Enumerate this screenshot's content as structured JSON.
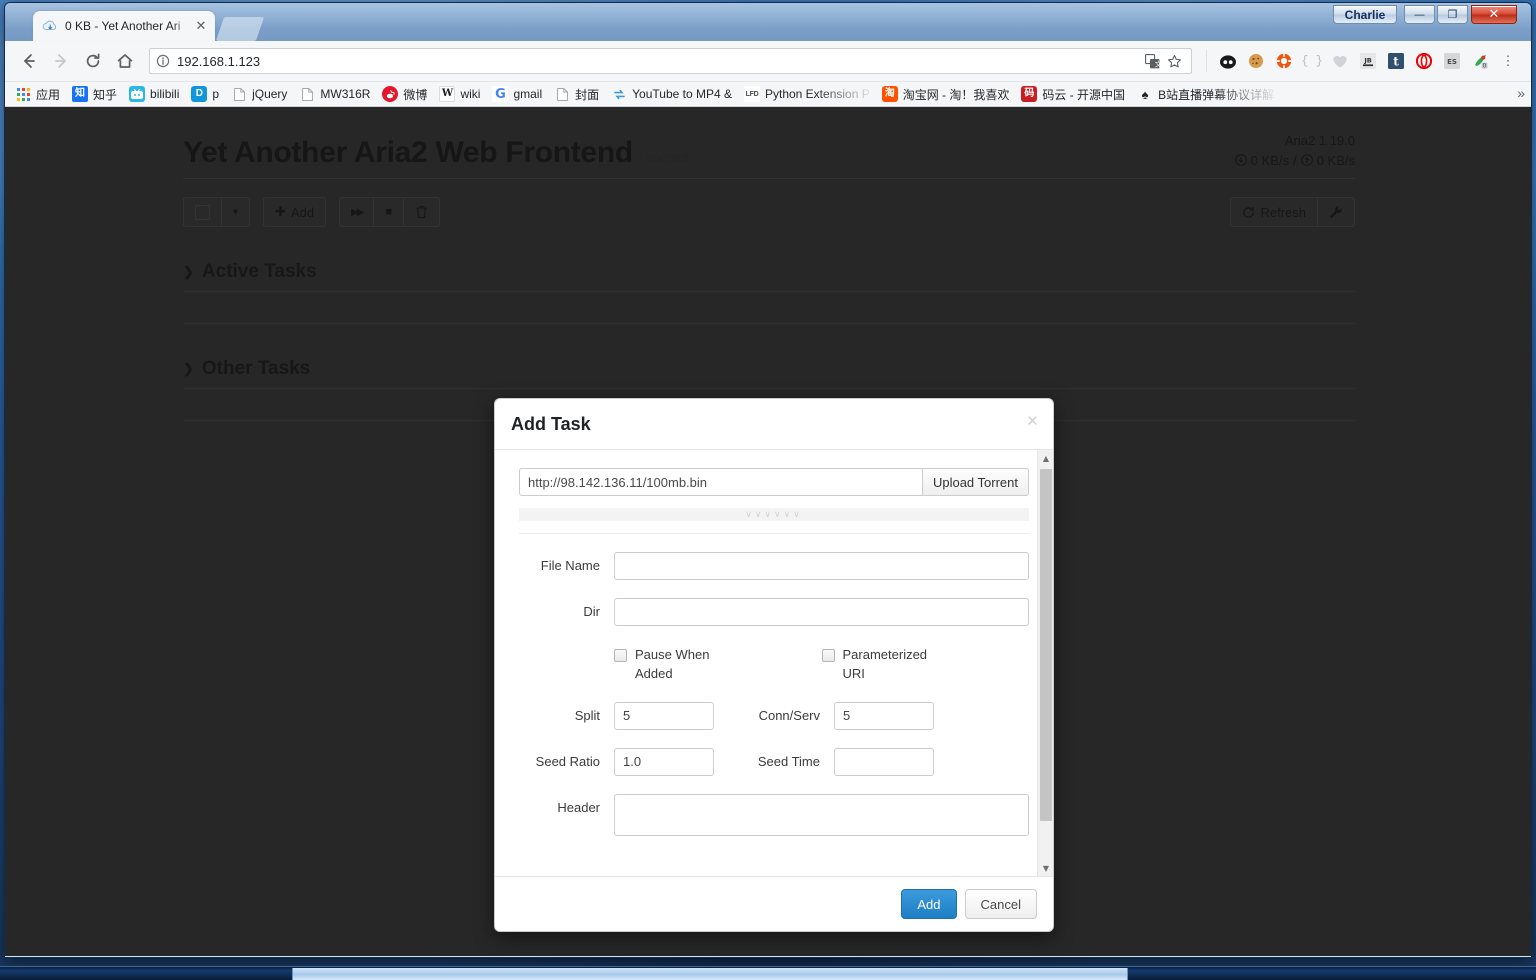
{
  "window": {
    "user_chip": "Charlie",
    "minimize_glyph": "—",
    "maximize_glyph": "❐",
    "close_glyph": "✕"
  },
  "browser": {
    "tab": {
      "title": "0 KB - Yet Another Ari",
      "close_glyph": "✕",
      "favicon_name": "cloud-download-icon"
    },
    "url": "192.168.1.123",
    "nav": {
      "back": "←",
      "forward": "→",
      "reload": "⟳",
      "home": "⌂"
    },
    "omnibox_icons": [
      "translate-icon",
      "star-icon"
    ],
    "extensions": [
      "panda-icon",
      "cookie-icon",
      "lifebuoy-icon",
      "braces-icon",
      "heart-icon",
      "jb-icon",
      "tumblr-icon",
      "opera-icon",
      "es-icon",
      "aria2-icon"
    ],
    "menu_glyph": "⋮",
    "bookmarks": [
      {
        "label": "应用",
        "icon": "apps-grid-icon"
      },
      {
        "label": "知乎",
        "icon": "zhihu-icon"
      },
      {
        "label": "bilibili",
        "icon": "bilibili-icon"
      },
      {
        "label": "p",
        "icon": "p-icon"
      },
      {
        "label": "jQuery",
        "icon": "page-icon"
      },
      {
        "label": "MW316R",
        "icon": "page-icon"
      },
      {
        "label": "微博",
        "icon": "weibo-icon"
      },
      {
        "label": "wiki",
        "icon": "wikipedia-icon"
      },
      {
        "label": "gmail",
        "icon": "google-icon"
      },
      {
        "label": "封面",
        "icon": "page-icon"
      },
      {
        "label": "YouTube to MP4 &",
        "icon": "convert-icon"
      },
      {
        "label": "Python Extension P",
        "icon": "lfd-icon"
      },
      {
        "label": "淘宝网 - 淘！我喜欢",
        "icon": "taobao-icon"
      },
      {
        "label": "码云 - 开源中国",
        "icon": "gitee-icon"
      },
      {
        "label": "B站直播弹幕协议详解",
        "icon": "spade-icon"
      }
    ],
    "bookmarks_overflow_glyph": "»"
  },
  "app": {
    "title": "Yet Another Aria2 Web Frontend",
    "cached_label": "cached",
    "version": "Aria2 1.19.0",
    "download_speed": "0 KB/s",
    "upload_speed": "0 KB/s",
    "speed_separator": "/",
    "toolbar": {
      "select_all_caret": "▾",
      "add_label": "Add",
      "add_glyph": "✚",
      "resume_glyph": "▶▶",
      "stop_glyph": "■",
      "delete_glyph": "🗑",
      "refresh_label": "Refresh",
      "refresh_glyph": "⟳",
      "settings_glyph": "🔧"
    },
    "sections": [
      {
        "name": "Active Tasks",
        "caret": "❯",
        "rows": 1
      },
      {
        "name": "Other Tasks",
        "caret": "❯",
        "rows": 1
      }
    ]
  },
  "modal": {
    "title": "Add Task",
    "close_glyph": "×",
    "uri_value": "http://98.142.136.11/100mb.bin",
    "uri_placeholder": "",
    "upload_torrent_label": "Upload Torrent",
    "resize_handle_glyphs": "∨∨∨∨∨∨",
    "fields": {
      "file_name_label": "File Name",
      "file_name_value": "",
      "dir_label": "Dir",
      "dir_value": "",
      "pause_when_added_label": "Pause When Added",
      "parameterized_uri_label": "Parameterized URI",
      "split_label": "Split",
      "split_value": "5",
      "conn_serv_label": "Conn/Serv",
      "conn_serv_value": "5",
      "seed_ratio_label": "Seed Ratio",
      "seed_ratio_value": "1.0",
      "seed_time_label": "Seed Time",
      "seed_time_value": "",
      "header_label": "Header",
      "header_value": ""
    },
    "footer": {
      "add_label": "Add",
      "cancel_label": "Cancel"
    },
    "scrollbar": {
      "up_glyph": "▲",
      "down_glyph": "▼"
    }
  },
  "colors": {
    "page_bg": "#303030",
    "modal_bg": "#ffffff",
    "primary_button": "#1d7fc4",
    "title_bar": "#2f6fb5"
  }
}
